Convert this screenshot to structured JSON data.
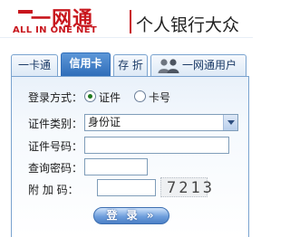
{
  "header": {
    "logo_main": "一网通",
    "logo_sub": "ALL IN ONE NET",
    "title": "个人银行大众"
  },
  "tabs": [
    {
      "label": "一卡通",
      "active": false
    },
    {
      "label": "信用卡",
      "active": true
    },
    {
      "label": "存 折",
      "active": false
    },
    {
      "label": "一网通用户",
      "active": false,
      "icon": "users-icon"
    }
  ],
  "form": {
    "login_method_label": "登录方式：",
    "options": [
      {
        "label": "证件",
        "checked": true
      },
      {
        "label": "卡号",
        "checked": false
      }
    ],
    "id_type_label": "证件类别：",
    "id_type_selected": "身份证",
    "id_number_label": "证件号码：",
    "id_number_value": "",
    "password_label": "查询密码：",
    "password_value": "",
    "code_label": "附 加 码：",
    "code_value": "",
    "captcha_text": "7213",
    "login_button": "登 录 »"
  },
  "colors": {
    "brand_red": "#c8161d",
    "tab_active": "#2f6db9",
    "border_blue": "#7aa3cf"
  }
}
